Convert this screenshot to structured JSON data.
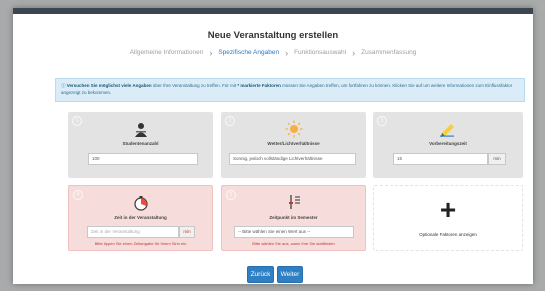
{
  "dialog": {
    "title": "Neue Veranstaltung erstellen"
  },
  "steps": [
    {
      "label": "Allgemeine Informationen",
      "active": false
    },
    {
      "label": "Spezifische Angaben",
      "active": true
    },
    {
      "label": "Funktionsauswahl",
      "active": false
    },
    {
      "label": "Zusammenfassung",
      "active": false
    }
  ],
  "info": {
    "prefix": "Versuchen Sie möglichst viele Angaben",
    "text_1": " über Ihre Veranstaltung zu treffen. Für mit ",
    "highlight": "* markierte Faktoren",
    "text_2": " müssen Sie Angaben treffen, um fortfahren zu können. Klicken Sie auf ",
    "text_3": " um weitere Informationen zum Einflussfaktor angezeigt zu bekommen.",
    "icon": "info-icon",
    "accent": "#2f6e8e"
  },
  "cards": {
    "students": {
      "label": "Studentenanzahl",
      "value": "100",
      "icon": "student-icon"
    },
    "weather": {
      "label": "Wetter/Lichtverhältnisse",
      "value": "Sonnig, jedoch vollständige Lichtverhältnisse",
      "icon": "sun-icon"
    },
    "prep": {
      "label": "Vorbereitungszeit",
      "value": "15",
      "unit": "min",
      "icon": "pencil-icon"
    },
    "duration": {
      "label": "Zeit in der Veranstaltung",
      "placeholder": "Zeit in der Veranstaltung",
      "unit": "min",
      "hint": "Bitte tippen Sie einen Zeitangabe für Ihrem Sinn ein",
      "icon": "timer-icon"
    },
    "semester": {
      "label": "Zeitpunkt im Semester",
      "placeholder": "-- Bitte wählen Sie einen Wert aus --",
      "hint": "Bitte wählen Sie aus, wann Ihre Sie stattfinden",
      "icon": "sliders-icon"
    },
    "optional": {
      "label": "Optionale Faktoren anzeigen",
      "icon": "plus-icon"
    }
  },
  "buttons": {
    "back": "Zurück",
    "next": "Weiter"
  }
}
